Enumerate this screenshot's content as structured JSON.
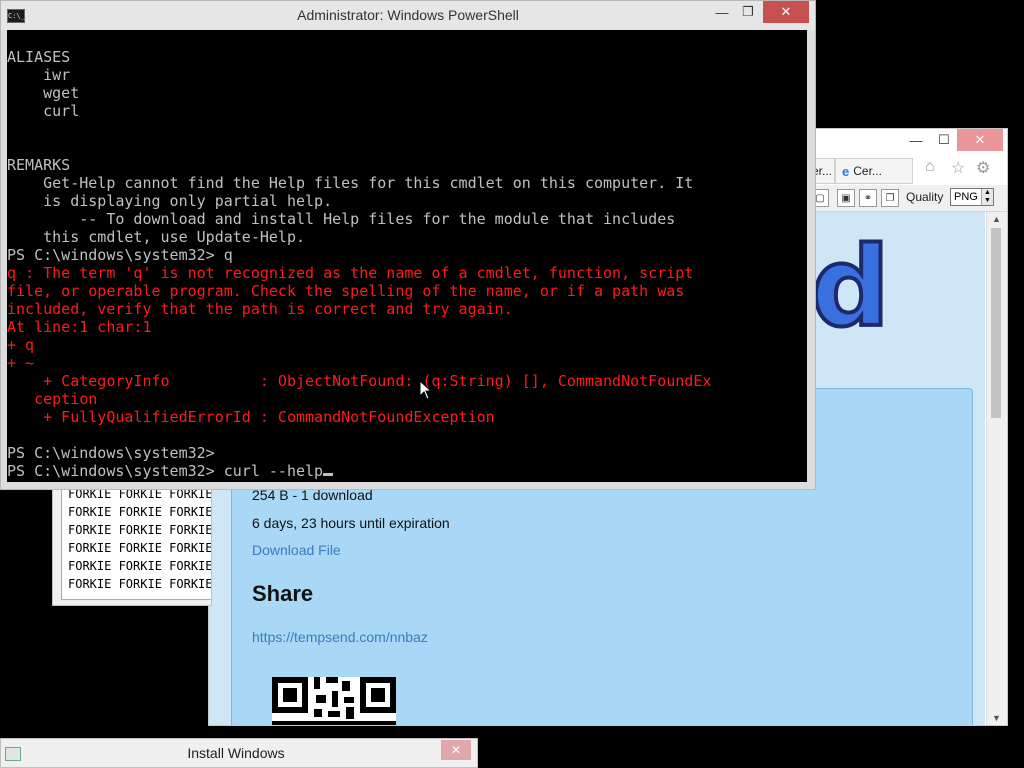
{
  "powershell": {
    "title": "Administrator: Windows PowerShell",
    "app_icon": "C:\\_",
    "controls": {
      "minimize": "—",
      "maximize": "❐",
      "close": "✕"
    },
    "lines": [
      {
        "text": "ALIASES",
        "color": "gray"
      },
      {
        "text": "    iwr",
        "color": "gray"
      },
      {
        "text": "    wget",
        "color": "gray"
      },
      {
        "text": "    curl",
        "color": "gray"
      },
      {
        "text": "",
        "color": "gray"
      },
      {
        "text": "",
        "color": "gray"
      },
      {
        "text": "REMARKS",
        "color": "gray"
      },
      {
        "text": "    Get-Help cannot find the Help files for this cmdlet on this computer. It",
        "color": "gray"
      },
      {
        "text": "    is displaying only partial help.",
        "color": "gray"
      },
      {
        "text": "        -- To download and install Help files for the module that includes",
        "color": "gray"
      },
      {
        "text": "    this cmdlet, use Update-Help.",
        "color": "gray"
      },
      {
        "text": "PS C:\\windows\\system32> q",
        "color": "gray"
      },
      {
        "text": "q : The term 'q' is not recognized as the name of a cmdlet, function, script",
        "color": "red"
      },
      {
        "text": "file, or operable program. Check the spelling of the name, or if a path was",
        "color": "red"
      },
      {
        "text": "included, verify that the path is correct and try again.",
        "color": "red"
      },
      {
        "text": "At line:1 char:1",
        "color": "red"
      },
      {
        "text": "+ q",
        "color": "red"
      },
      {
        "text": "+ ~",
        "color": "red"
      },
      {
        "text": "    + CategoryInfo          : ObjectNotFound: (q:String) [], CommandNotFoundEx",
        "color": "red"
      },
      {
        "text": "   ception",
        "color": "red"
      },
      {
        "text": "    + FullyQualifiedErrorId : CommandNotFoundException",
        "color": "red"
      },
      {
        "text": "",
        "color": "gray"
      },
      {
        "text": "PS C:\\windows\\system32>",
        "color": "gray"
      },
      {
        "text": "PS C:\\windows\\system32> curl --help",
        "color": "gray"
      }
    ]
  },
  "browser": {
    "controls": {
      "minimize": "—",
      "maximize": "☐",
      "close": "✕"
    },
    "tabs": [
      {
        "label": "er..."
      },
      {
        "label": "Cer..."
      }
    ],
    "tab_icons": [
      "home-icon",
      "star-icon",
      "gear-icon"
    ],
    "toolbar": {
      "quality_label": "Quality",
      "quality_value": "PNG"
    },
    "page": {
      "logo_letter": "d",
      "file_info": "254 B - 1 download",
      "expiration": "6 days, 23 hours until expiration",
      "download_link": "Download File",
      "share_heading": "Share",
      "share_url": "https://tempsend.com/nnbaz"
    }
  },
  "forkie": {
    "lines": [
      "FORKIE FORKIE FORKIE",
      "FORKIE FORKIE FORKIE",
      "FORKIE FORKIE FORKIE",
      "FORKIE FORKIE FORKIE",
      "FORKIE FORKIE FORKIE",
      "FORKIE FORKIE FORKIE"
    ]
  },
  "install_windows": {
    "title": "Install Windows",
    "close": "✕"
  }
}
